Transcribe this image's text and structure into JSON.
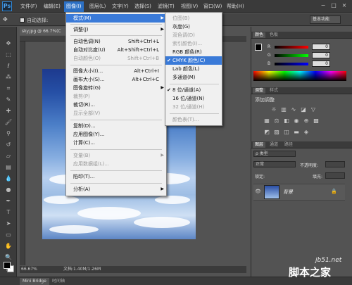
{
  "app": {
    "logo": "Ps"
  },
  "menubar": {
    "items": [
      "文件(F)",
      "编辑(E)",
      "图像(I)",
      "图层(L)",
      "文字(Y)",
      "选择(S)",
      "滤镜(T)",
      "视图(V)",
      "窗口(W)",
      "帮助(H)"
    ],
    "window_controls": [
      "−",
      "□",
      "×"
    ]
  },
  "options_bar": {
    "auto_select": "自动选择:",
    "essentials": "基本功能"
  },
  "document": {
    "tab": "sky.jpg @ 66.7%(C",
    "zoom": "66.67%",
    "doc_info": "文档:1.40M/1.26M"
  },
  "image_menu": {
    "items": [
      {
        "label": "模式(M)",
        "shortcut": "",
        "submenu": true,
        "disabled": false,
        "highlight": true
      },
      {
        "label": "调整(J)",
        "shortcut": "",
        "submenu": true,
        "disabled": false
      },
      {
        "label": "自动色调(N)",
        "shortcut": "Shift+Ctrl+L",
        "disabled": false
      },
      {
        "label": "自动对比度(U)",
        "shortcut": "Alt+Shift+Ctrl+L",
        "disabled": false
      },
      {
        "label": "自动颜色(O)",
        "shortcut": "Shift+Ctrl+B",
        "disabled": true
      },
      {
        "label": "图像大小(I)...",
        "shortcut": "Alt+Ctrl+I",
        "disabled": false
      },
      {
        "label": "画布大小(S)...",
        "shortcut": "Alt+Ctrl+C",
        "disabled": false
      },
      {
        "label": "图像旋转(G)",
        "shortcut": "",
        "submenu": true,
        "disabled": false
      },
      {
        "label": "裁剪(P)",
        "shortcut": "",
        "disabled": true
      },
      {
        "label": "裁切(R)...",
        "shortcut": "",
        "disabled": false
      },
      {
        "label": "显示全部(V)",
        "shortcut": "",
        "disabled": true
      },
      {
        "label": "复制(D)...",
        "shortcut": "",
        "disabled": false
      },
      {
        "label": "应用图像(Y)...",
        "shortcut": "",
        "disabled": false
      },
      {
        "label": "计算(C)...",
        "shortcut": "",
        "disabled": false
      },
      {
        "label": "变量(B)",
        "shortcut": "",
        "submenu": true,
        "disabled": true
      },
      {
        "label": "应用数据组(L)...",
        "shortcut": "",
        "disabled": true
      },
      {
        "label": "陷印(T)...",
        "shortcut": "",
        "disabled": false
      },
      {
        "label": "分析(A)",
        "shortcut": "",
        "submenu": true,
        "disabled": false
      }
    ]
  },
  "mode_menu": {
    "items": [
      {
        "label": "位图(B)",
        "disabled": true,
        "checked": false
      },
      {
        "label": "灰度(G)",
        "disabled": false,
        "checked": false
      },
      {
        "label": "双色调(D)",
        "disabled": true,
        "checked": false
      },
      {
        "label": "索引颜色(I)...",
        "disabled": true,
        "checked": false
      },
      {
        "label": "RGB 颜色(R)",
        "disabled": false,
        "checked": false
      },
      {
        "label": "CMYK 颜色(C)",
        "disabled": false,
        "checked": true,
        "highlight": true
      },
      {
        "label": "Lab 颜色(L)",
        "disabled": false,
        "checked": false
      },
      {
        "label": "多通道(M)",
        "disabled": false,
        "checked": false
      },
      {
        "label": "8 位/通道(A)",
        "disabled": false,
        "checked": true
      },
      {
        "label": "16 位/通道(N)",
        "disabled": false,
        "checked": false
      },
      {
        "label": "32 位/通道(H)",
        "disabled": true,
        "checked": false
      },
      {
        "label": "颜色表(T)...",
        "disabled": true,
        "checked": false
      }
    ]
  },
  "color_panel": {
    "tabs": [
      "颜色",
      "色板"
    ],
    "sliders": [
      {
        "label": "R",
        "value": "0"
      },
      {
        "label": "G",
        "value": "0"
      },
      {
        "label": "B",
        "value": "0"
      }
    ]
  },
  "adjust_panel": {
    "tabs": [
      "调整",
      "样式"
    ],
    "title": "添加调整"
  },
  "layers_panel": {
    "tabs": [
      "图层",
      "通道",
      "路径"
    ],
    "kind": "ρ 类型",
    "blend": "正常",
    "opacity_label": "不透明度:",
    "lock_label": "锁定:",
    "fill_label": "填充:",
    "layer_name": "背景"
  },
  "bottom_tabs": [
    "Mini Bridge",
    "时间轴"
  ],
  "watermark": {
    "line1": "jb51.net",
    "line2": "脚本之家"
  }
}
